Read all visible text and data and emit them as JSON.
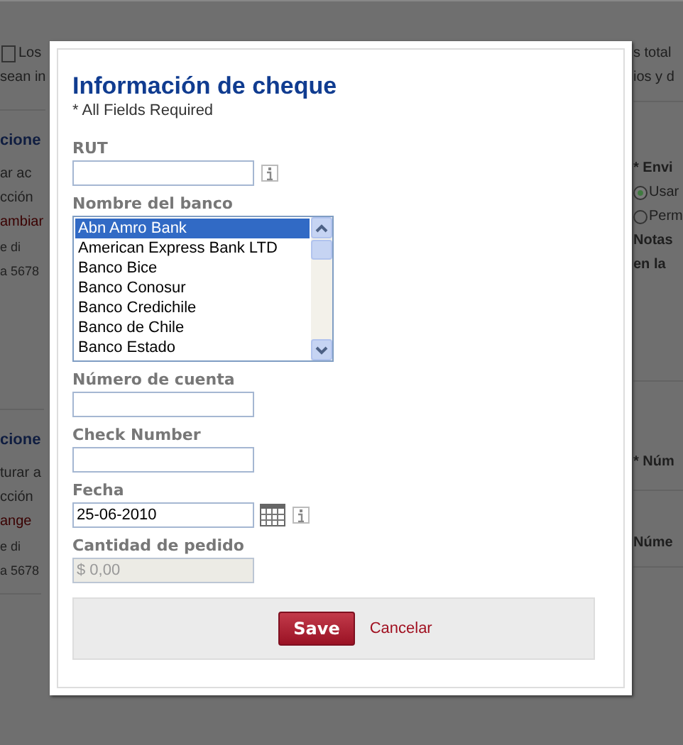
{
  "background": {
    "left": [
      {
        "lines": [
          {
            "kind": "checkbox",
            "text": "Los",
            "checked": false
          },
          {
            "kind": "text",
            "text": "sean in"
          }
        ]
      },
      {
        "lines": [
          {
            "kind": "heading",
            "text": "cione"
          },
          {
            "kind": "text",
            "text": "ar ac"
          },
          {
            "kind": "text",
            "text": "cción"
          },
          {
            "kind": "link",
            "text": "ambiar"
          },
          {
            "kind": "small",
            "text": "e di"
          },
          {
            "kind": "small",
            "text": "a 5678"
          }
        ]
      },
      {
        "lines": [
          {
            "kind": "heading",
            "text": "cione"
          },
          {
            "kind": "text",
            "text": "turar a"
          },
          {
            "kind": "text",
            "text": "cción"
          },
          {
            "kind": "link",
            "text": "ange"
          },
          {
            "kind": "small",
            "text": "e di"
          },
          {
            "kind": "small",
            "text": "a 5678"
          }
        ]
      }
    ],
    "right": [
      {
        "lines": [
          {
            "kind": "text",
            "text": "s total"
          },
          {
            "kind": "text",
            "text": "ios y d"
          }
        ]
      },
      {
        "lines": [
          {
            "kind": "label",
            "text": "* Envi"
          },
          {
            "kind": "radio",
            "text": "Usar",
            "selected": true
          },
          {
            "kind": "radio",
            "text": "Perm",
            "selected": false
          },
          {
            "kind": "label",
            "text": "Notas"
          },
          {
            "kind": "label",
            "text": "en la"
          }
        ]
      },
      {
        "lines": [
          {
            "kind": "label",
            "text": "* Núm"
          }
        ]
      },
      {
        "lines": [
          {
            "kind": "label",
            "text": "Núme"
          }
        ]
      }
    ]
  },
  "dialog": {
    "title": "Información de cheque",
    "note": "* All Fields Required",
    "fields": [
      {
        "kind": "text",
        "label": "RUT",
        "info": true,
        "disabled": false
      },
      {
        "kind": "listbox",
        "label": "Nombre del banco",
        "info": false,
        "disabled": false,
        "options": [
          {
            "text": "Abn Amro Bank",
            "selected": true
          },
          {
            "text": "American Express Bank LTD",
            "selected": false
          },
          {
            "text": "Banco Bice",
            "selected": false
          },
          {
            "text": "Banco Conosur",
            "selected": false
          },
          {
            "text": "Banco Credichile",
            "selected": false
          },
          {
            "text": "Banco de Chile",
            "selected": false
          },
          {
            "text": "Banco Estado",
            "selected": false
          }
        ]
      },
      {
        "kind": "text",
        "label": "Número de cuenta",
        "info": false,
        "disabled": false
      },
      {
        "kind": "text",
        "label": "Check Number",
        "info": false,
        "disabled": false
      },
      {
        "kind": "date",
        "label": "Fecha",
        "value": "25-06-2010",
        "info": true,
        "disabled": false
      },
      {
        "kind": "text",
        "label": "Cantidad de pedido",
        "value": "$ 0,00",
        "info": false,
        "disabled": true
      }
    ],
    "save": "Save",
    "cancel": "Cancelar"
  }
}
